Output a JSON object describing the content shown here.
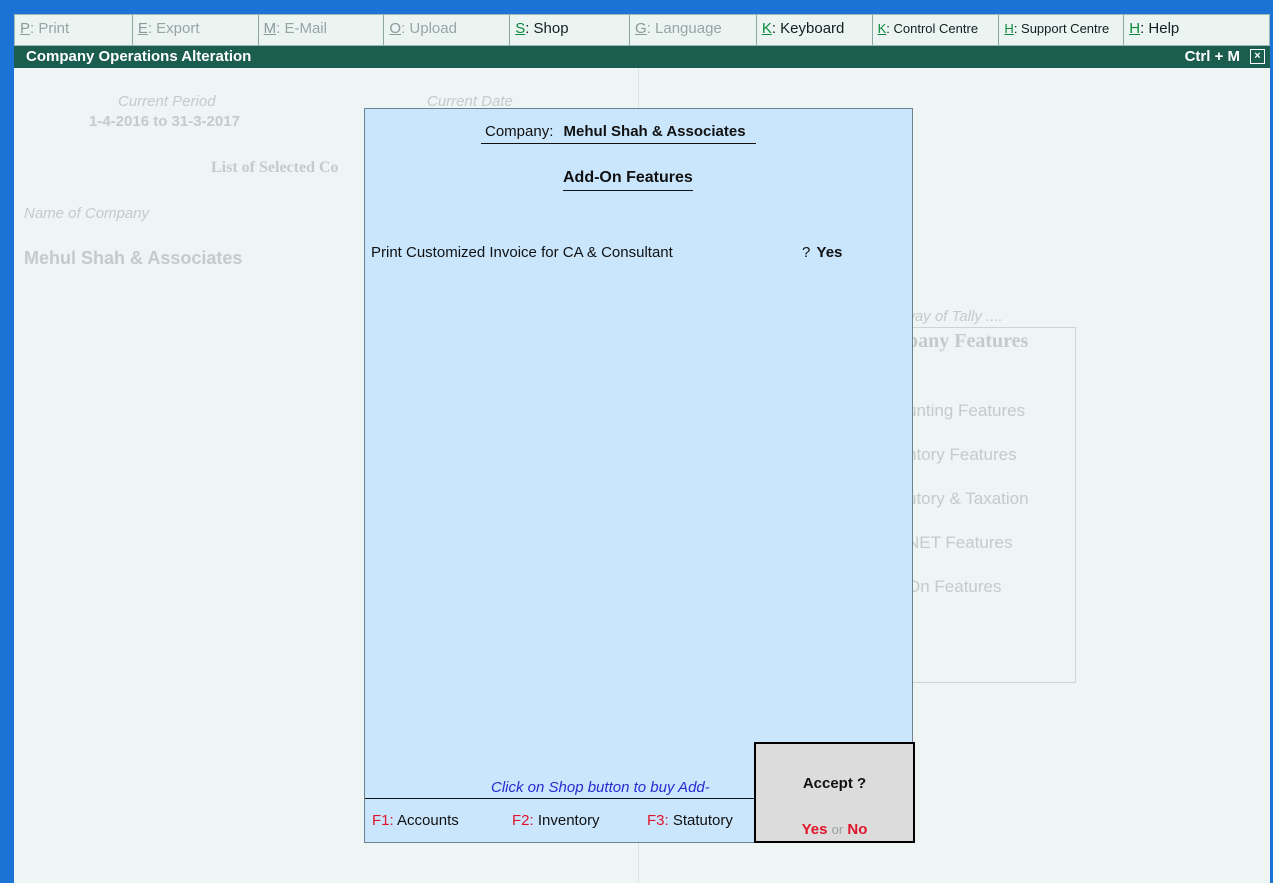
{
  "toolbar": {
    "items": [
      {
        "key": "P",
        "label": ": Print"
      },
      {
        "key": "E",
        "label": ": Export"
      },
      {
        "key": "M",
        "label": ": E-Mail"
      },
      {
        "key": "O",
        "label": ": Upload"
      },
      {
        "key": "S",
        "label": ": Shop"
      },
      {
        "key": "G",
        "label": ": Language"
      },
      {
        "key": "K",
        "label": ": Keyboard"
      },
      {
        "key": "K",
        "label": ": Control Centre"
      },
      {
        "key": "H",
        "label": ": Support Centre"
      },
      {
        "key": "H",
        "label": ": Help"
      }
    ]
  },
  "title_bar": {
    "title": "Company Operations  Alteration",
    "shortcut": "Ctrl + M",
    "close": "×"
  },
  "background": {
    "current_period_label": "Current Period",
    "current_period_value": "1-4-2016 to 31-3-2017",
    "current_date_label": "Current Date",
    "list_heading": "List of Selected Co",
    "name_label": "Name of Company",
    "company_name": "Mehul Shah & Associates",
    "tally_hint": "way of Tally ....",
    "features_heading": "pany Features",
    "features": [
      "unting Features",
      "ntory Features",
      "utory & Taxation",
      "NET Features",
      "On Features"
    ]
  },
  "panel": {
    "company_label": "Company:",
    "company_name": "Mehul Shah & Associates",
    "section_title": "Add-On Features",
    "option_label": "Print Customized Invoice for CA & Consultant",
    "option_question": "?",
    "option_value": "Yes",
    "shop_hint": "Click on Shop button to buy Add-",
    "fkeys": [
      {
        "key": "F1:",
        "label": "Accounts"
      },
      {
        "key": "F2:",
        "label": "Inventory"
      },
      {
        "key": "F3:",
        "label": "Statutory"
      }
    ]
  },
  "dialog": {
    "question": "Accept ?",
    "yes": "Yes",
    "or": "or",
    "no": "No"
  }
}
